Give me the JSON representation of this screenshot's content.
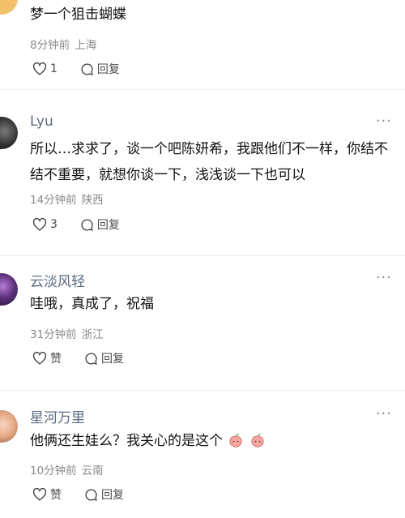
{
  "comments": [
    {
      "user": "",
      "content": "梦一个狙击蝴蝶",
      "time": "8分钟前",
      "location": "上海",
      "like_label": "1",
      "reply_label": "回复"
    },
    {
      "user": "Lyu",
      "content": "所以…求求了，谈一个吧陈妍希，我跟他们不一样，你结不结不重要，就想你谈一下，浅浅谈一下也可以",
      "time": "14分钟前",
      "location": "陕西",
      "like_label": "3",
      "reply_label": "回复",
      "more": "···"
    },
    {
      "user": "云淡风轻",
      "content": "哇哦，真成了，祝福",
      "time": "31分钟前",
      "location": "浙江",
      "like_label": "赞",
      "reply_label": "回复",
      "more": "···"
    },
    {
      "user": "星河万里",
      "content": "他俩还生娃么？我关心的是这个",
      "time": "10分钟前",
      "location": "云南",
      "like_label": "赞",
      "reply_label": "回复",
      "more": "···"
    }
  ],
  "icons": {
    "like": "heart-icon",
    "reply": "speech-bubble-icon",
    "emoji": "peach-emoji-icon"
  },
  "colors": {
    "username": "#5a6b82",
    "meta": "#8a8a8a",
    "text": "#111111"
  }
}
